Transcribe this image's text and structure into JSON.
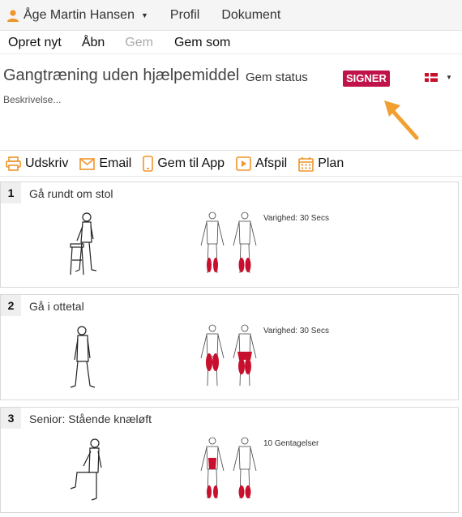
{
  "header": {
    "user_name": "Åge Martin Hansen",
    "user_icon": "person-icon",
    "menu": [
      "Profil",
      "Dokument"
    ],
    "accent": "#f0952a"
  },
  "actions": {
    "opret": "Opret nyt",
    "abn": "Åbn",
    "gem": "Gem",
    "gem_som": "Gem som"
  },
  "program": {
    "title": "Gangtræning uden hjælpemiddel",
    "gem_status": "Gem status",
    "signer": "SIGNER",
    "signer_color": "#c0134a",
    "language_flag": "flag-dk-icon",
    "description_placeholder": "Beskrivelse..."
  },
  "toolbar": {
    "udskriv": "Udskriv",
    "email": "Email",
    "gem_app": "Gem til App",
    "afspil": "Afspil",
    "plan": "Plan"
  },
  "exercises": [
    {
      "num": "1",
      "title": "Gå rundt om stol",
      "detail": "Varighed: 30 Secs"
    },
    {
      "num": "2",
      "title": "Gå i ottetal",
      "detail": "Varighed: 30 Secs"
    },
    {
      "num": "3",
      "title": "Senior: Stående knæløft",
      "detail": "10 Gentagelser"
    }
  ]
}
